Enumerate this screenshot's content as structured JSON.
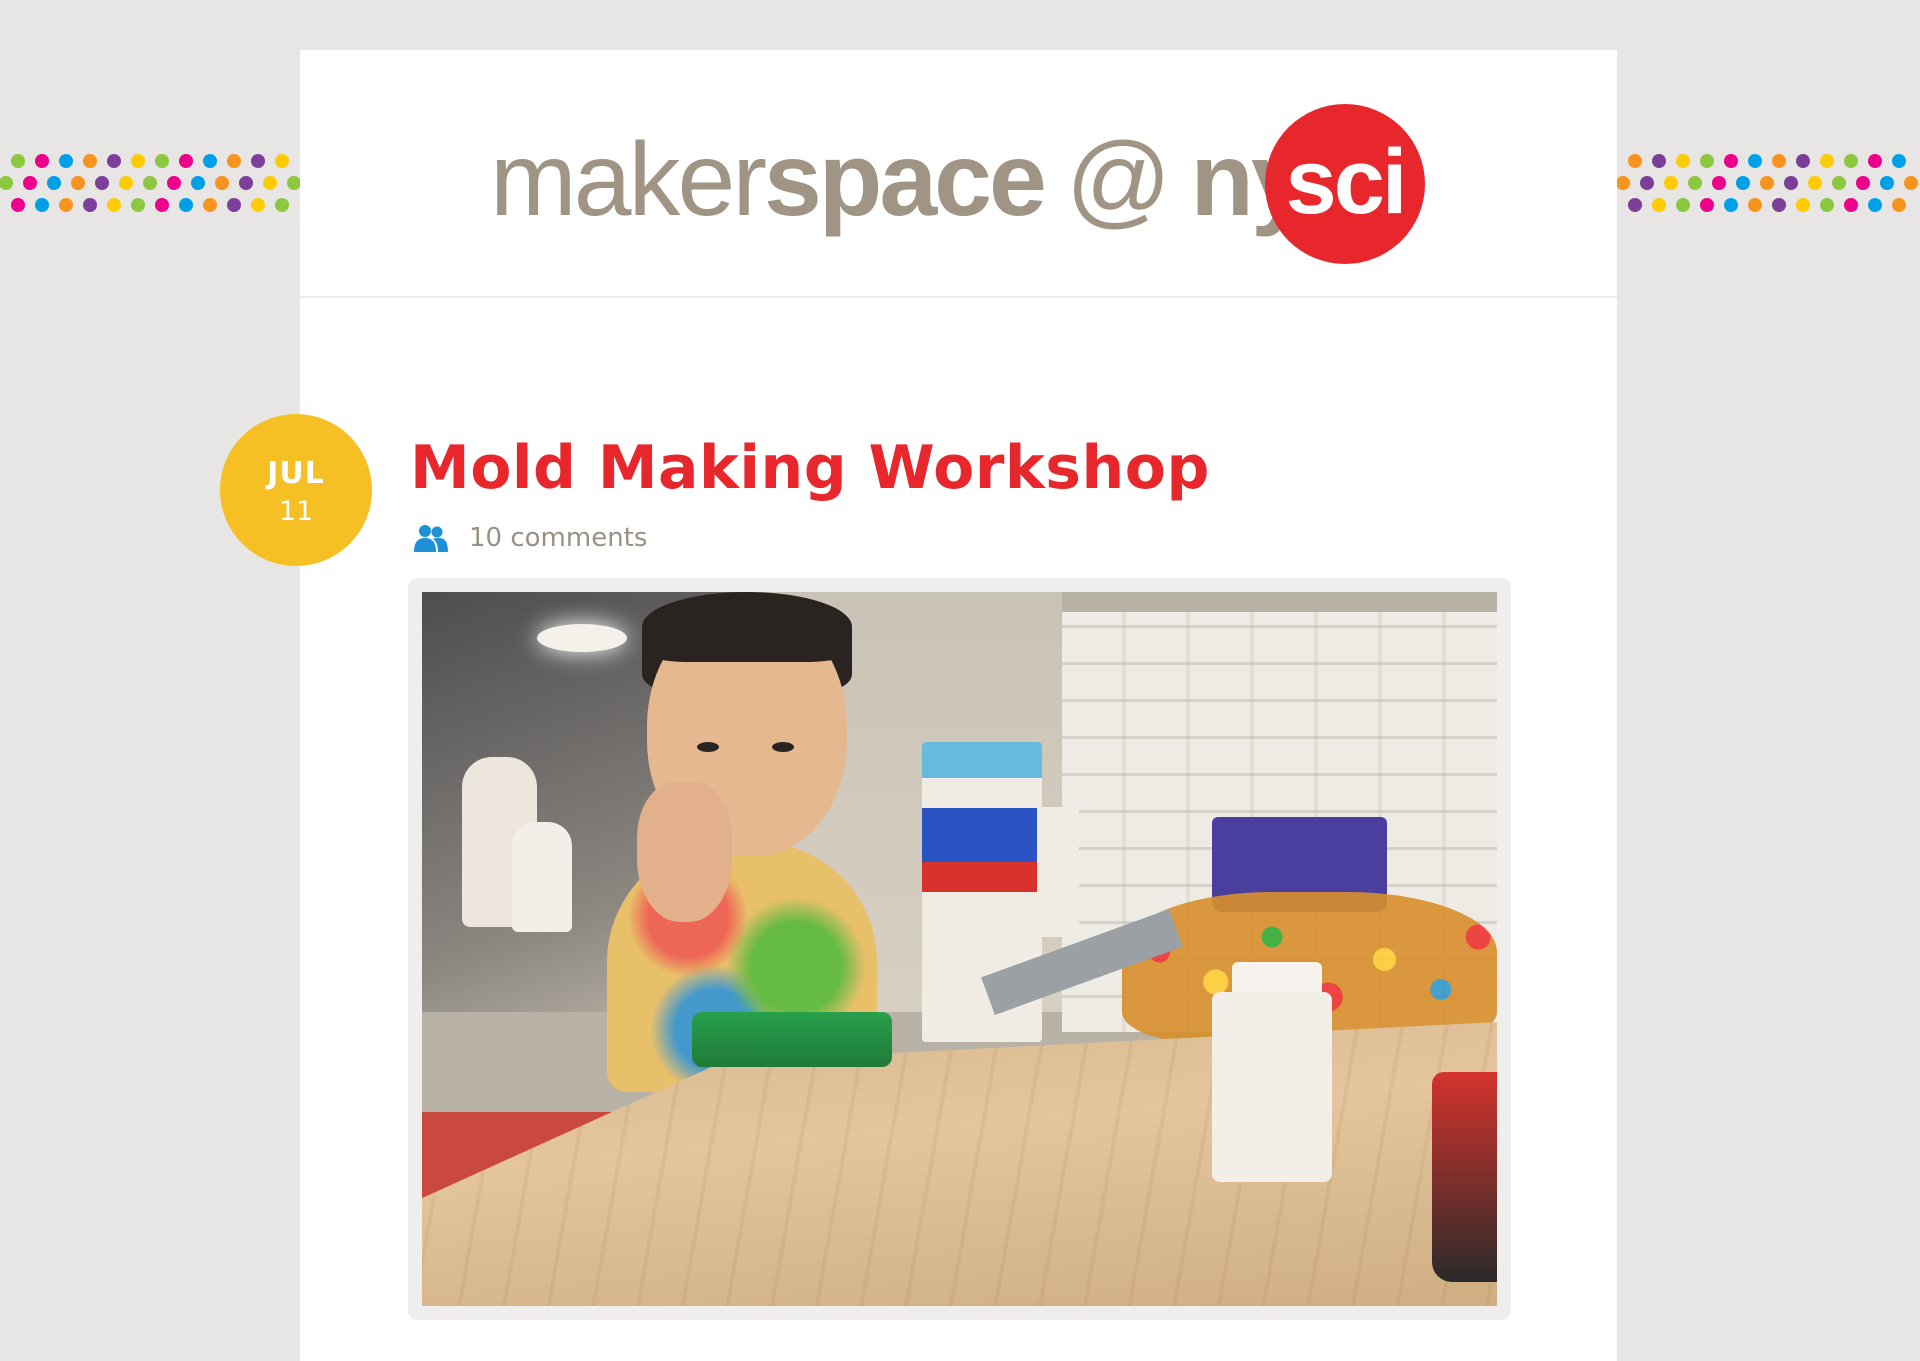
{
  "colors": {
    "page_background": "#e7e6e4",
    "panel_background": "#ffffff",
    "logo_gray": "#a09585",
    "brand_red": "#e8272d",
    "date_badge_yellow": "#f6bf23",
    "meta_gray": "#9a9184",
    "icon_blue": "#1e90d6",
    "dot_colors": [
      "#8dc63f",
      "#ec008c",
      "#00a0e9",
      "#f7941d",
      "#7b3f99",
      "#ffcb05"
    ]
  },
  "header": {
    "logo_text_thin": "maker",
    "logo_text_bold": "space",
    "logo_text_at": "@",
    "logo_text_ny": "ny",
    "logo_text_sci": "sci"
  },
  "post": {
    "date_month": "JUL",
    "date_day": "11",
    "title": "Mold Making Workshop",
    "comments_icon": "users-icon",
    "comments_label": "10 comments",
    "photo_icon": "photo-image"
  }
}
